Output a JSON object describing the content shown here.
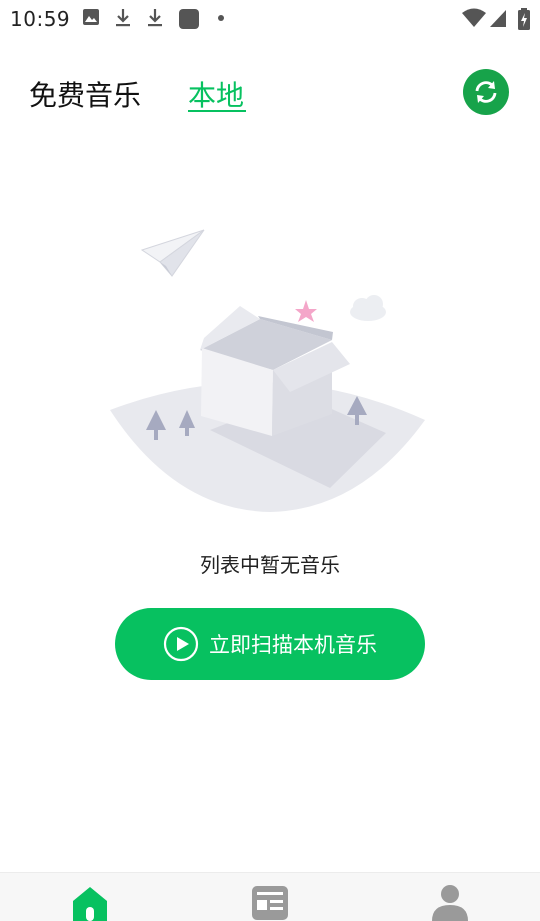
{
  "status_bar": {
    "time": "10:59",
    "icons": [
      "image-icon",
      "download-icon",
      "download-icon",
      "app-square-icon",
      "dot-icon",
      "wifi-icon",
      "signal-icon",
      "battery-charging-icon"
    ]
  },
  "tabs": [
    {
      "label": "免费音乐",
      "active": false
    },
    {
      "label": "本地",
      "active": true
    }
  ],
  "refresh_icon": "refresh-icon",
  "empty_state": {
    "message": "列表中暂无音乐",
    "illustration": "empty-box-illustration"
  },
  "scan_button": {
    "label": "立即扫描本机音乐",
    "icon": "play-circle-icon"
  },
  "bottom_nav": {
    "items": [
      "home-icon",
      "news-icon",
      "profile-icon"
    ],
    "active": "home-icon"
  },
  "colors": {
    "accent": "#07c160",
    "refresh_bg": "#17a34a",
    "nav_active": "#07c160",
    "nav_inactive": "#9a9a9a"
  }
}
